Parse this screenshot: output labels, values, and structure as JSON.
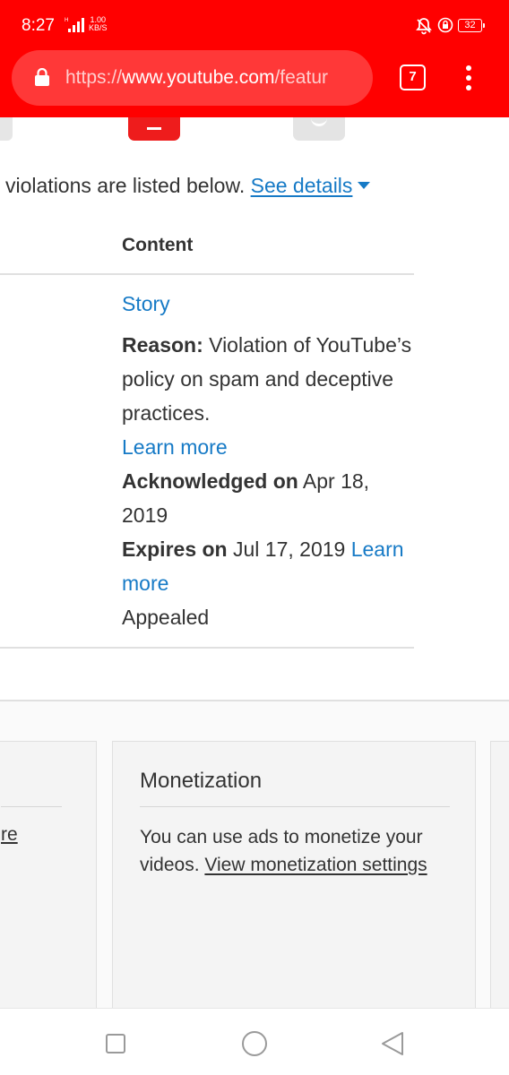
{
  "status_bar": {
    "time": "8:27",
    "network_type": "H",
    "speed_value": "1.00",
    "speed_unit": "KB/S",
    "battery": "32"
  },
  "browser": {
    "url_scheme": "https://",
    "url_host": "www.youtube.com",
    "url_path": "/featur",
    "tab_count": "7",
    "brand_color": "#ff0000"
  },
  "strikes": {
    "intro_text": "violations are listed below.",
    "see_details_label": "See details",
    "column_header": "Content",
    "item": {
      "title": "Story",
      "reason_label": "Reason:",
      "reason_text": "Violation of YouTube’s policy on spam and deceptive practices.",
      "learn_more": "Learn more",
      "acknowledged_label": "Acknowledged on",
      "acknowledged_date": "Apr 18, 2019",
      "expires_label": "Expires on",
      "expires_date": "Jul 17, 2019",
      "expires_learn_more": "Learn more",
      "status": "Appealed"
    }
  },
  "cards": {
    "left_partial_link": "re",
    "monetization": {
      "title": "Monetization",
      "body": "You can use ads to monetize your videos.",
      "link": "View monetization settings"
    }
  },
  "colors": {
    "link": "#167ac6",
    "strike_icon": "#ee1c1c"
  }
}
